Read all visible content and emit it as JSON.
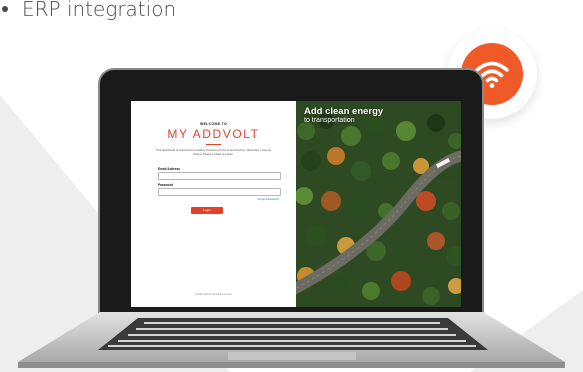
{
  "bullet": {
    "text": "ERP integration"
  },
  "badge": {
    "icon": "wifi-icon",
    "color": "#f05a28"
  },
  "login": {
    "welcome": "WELCOME TO",
    "brand": "MY ADDVOLT",
    "intro": "This dashboard is optimized for desktop browsers (Chrome and Firefox). Otherwise it may be limited. Please contact our team.",
    "email_label": "Email Address",
    "password_label": "Password",
    "forgot_link": "Forgot Password?",
    "login_button": "Login",
    "footer": "© 2021 AddVolt. All rights reserved.",
    "accent": "#e4412a"
  },
  "promo": {
    "title": "Add clean energy",
    "subtitle": "to transportation"
  }
}
